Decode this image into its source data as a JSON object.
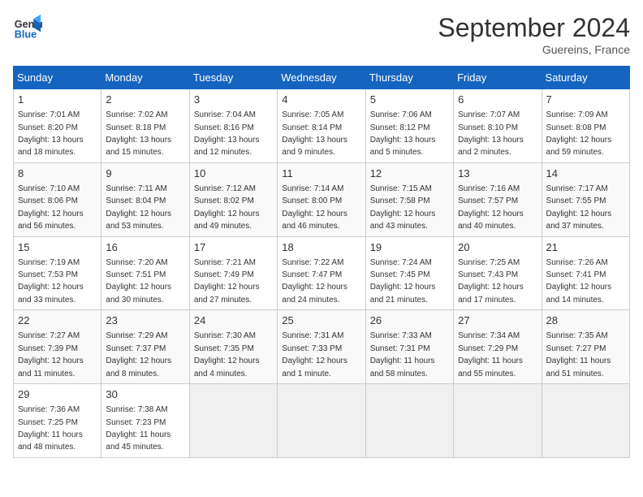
{
  "logo": {
    "line1": "General",
    "line2": "Blue"
  },
  "title": "September 2024",
  "subtitle": "Guereins, France",
  "headers": [
    "Sunday",
    "Monday",
    "Tuesday",
    "Wednesday",
    "Thursday",
    "Friday",
    "Saturday"
  ],
  "weeks": [
    [
      {
        "day": "1",
        "info": "Sunrise: 7:01 AM\nSunset: 8:20 PM\nDaylight: 13 hours\nand 18 minutes."
      },
      {
        "day": "2",
        "info": "Sunrise: 7:02 AM\nSunset: 8:18 PM\nDaylight: 13 hours\nand 15 minutes."
      },
      {
        "day": "3",
        "info": "Sunrise: 7:04 AM\nSunset: 8:16 PM\nDaylight: 13 hours\nand 12 minutes."
      },
      {
        "day": "4",
        "info": "Sunrise: 7:05 AM\nSunset: 8:14 PM\nDaylight: 13 hours\nand 9 minutes."
      },
      {
        "day": "5",
        "info": "Sunrise: 7:06 AM\nSunset: 8:12 PM\nDaylight: 13 hours\nand 5 minutes."
      },
      {
        "day": "6",
        "info": "Sunrise: 7:07 AM\nSunset: 8:10 PM\nDaylight: 13 hours\nand 2 minutes."
      },
      {
        "day": "7",
        "info": "Sunrise: 7:09 AM\nSunset: 8:08 PM\nDaylight: 12 hours\nand 59 minutes."
      }
    ],
    [
      {
        "day": "8",
        "info": "Sunrise: 7:10 AM\nSunset: 8:06 PM\nDaylight: 12 hours\nand 56 minutes."
      },
      {
        "day": "9",
        "info": "Sunrise: 7:11 AM\nSunset: 8:04 PM\nDaylight: 12 hours\nand 53 minutes."
      },
      {
        "day": "10",
        "info": "Sunrise: 7:12 AM\nSunset: 8:02 PM\nDaylight: 12 hours\nand 49 minutes."
      },
      {
        "day": "11",
        "info": "Sunrise: 7:14 AM\nSunset: 8:00 PM\nDaylight: 12 hours\nand 46 minutes."
      },
      {
        "day": "12",
        "info": "Sunrise: 7:15 AM\nSunset: 7:58 PM\nDaylight: 12 hours\nand 43 minutes."
      },
      {
        "day": "13",
        "info": "Sunrise: 7:16 AM\nSunset: 7:57 PM\nDaylight: 12 hours\nand 40 minutes."
      },
      {
        "day": "14",
        "info": "Sunrise: 7:17 AM\nSunset: 7:55 PM\nDaylight: 12 hours\nand 37 minutes."
      }
    ],
    [
      {
        "day": "15",
        "info": "Sunrise: 7:19 AM\nSunset: 7:53 PM\nDaylight: 12 hours\nand 33 minutes."
      },
      {
        "day": "16",
        "info": "Sunrise: 7:20 AM\nSunset: 7:51 PM\nDaylight: 12 hours\nand 30 minutes."
      },
      {
        "day": "17",
        "info": "Sunrise: 7:21 AM\nSunset: 7:49 PM\nDaylight: 12 hours\nand 27 minutes."
      },
      {
        "day": "18",
        "info": "Sunrise: 7:22 AM\nSunset: 7:47 PM\nDaylight: 12 hours\nand 24 minutes."
      },
      {
        "day": "19",
        "info": "Sunrise: 7:24 AM\nSunset: 7:45 PM\nDaylight: 12 hours\nand 21 minutes."
      },
      {
        "day": "20",
        "info": "Sunrise: 7:25 AM\nSunset: 7:43 PM\nDaylight: 12 hours\nand 17 minutes."
      },
      {
        "day": "21",
        "info": "Sunrise: 7:26 AM\nSunset: 7:41 PM\nDaylight: 12 hours\nand 14 minutes."
      }
    ],
    [
      {
        "day": "22",
        "info": "Sunrise: 7:27 AM\nSunset: 7:39 PM\nDaylight: 12 hours\nand 11 minutes."
      },
      {
        "day": "23",
        "info": "Sunrise: 7:29 AM\nSunset: 7:37 PM\nDaylight: 12 hours\nand 8 minutes."
      },
      {
        "day": "24",
        "info": "Sunrise: 7:30 AM\nSunset: 7:35 PM\nDaylight: 12 hours\nand 4 minutes."
      },
      {
        "day": "25",
        "info": "Sunrise: 7:31 AM\nSunset: 7:33 PM\nDaylight: 12 hours\nand 1 minute."
      },
      {
        "day": "26",
        "info": "Sunrise: 7:33 AM\nSunset: 7:31 PM\nDaylight: 11 hours\nand 58 minutes."
      },
      {
        "day": "27",
        "info": "Sunrise: 7:34 AM\nSunset: 7:29 PM\nDaylight: 11 hours\nand 55 minutes."
      },
      {
        "day": "28",
        "info": "Sunrise: 7:35 AM\nSunset: 7:27 PM\nDaylight: 11 hours\nand 51 minutes."
      }
    ],
    [
      {
        "day": "29",
        "info": "Sunrise: 7:36 AM\nSunset: 7:25 PM\nDaylight: 11 hours\nand 48 minutes."
      },
      {
        "day": "30",
        "info": "Sunrise: 7:38 AM\nSunset: 7:23 PM\nDaylight: 11 hours\nand 45 minutes."
      },
      null,
      null,
      null,
      null,
      null
    ]
  ]
}
